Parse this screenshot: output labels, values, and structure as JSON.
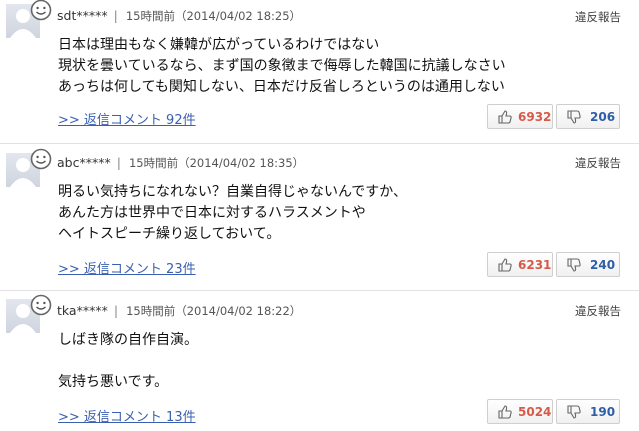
{
  "report_label": "違反報告",
  "comments": [
    {
      "user": "sdt*****",
      "separator": "|",
      "meta": "15時間前（2014/04/02 18:25）",
      "lines": [
        "日本は理由もなく嫌韓が広がっているわけではない",
        "現状を曇いているなら、まず国の象徴まで侮辱した韓国に抗議しなさい",
        "あっちは何しても関知しない、日本だけ反省しろというのは通用しない"
      ],
      "reply": ">> 返信コメント 92件",
      "likes": "6932",
      "dislikes": "206"
    },
    {
      "user": "abc*****",
      "separator": "|",
      "meta": "15時間前（2014/04/02 18:35）",
      "lines": [
        "明るい気持ちになれない？自業自得じゃないんですか、",
        "あんた方は世界中で日本に対するハラスメントや",
        "ヘイトスピーチ繰り返しておいて。"
      ],
      "reply": ">> 返信コメント 23件",
      "likes": "6231",
      "dislikes": "240"
    },
    {
      "user": "tka*****",
      "separator": "|",
      "meta": "15時間前（2014/04/02 18:22）",
      "lines": [
        "しばき隊の自作自演。",
        "",
        "気持ち悪いです。"
      ],
      "reply": ">> 返信コメント 13件",
      "likes": "5024",
      "dislikes": "190"
    }
  ],
  "colors": {
    "like": "#d65a4a",
    "dislike": "#2f5ea8",
    "link": "#3a5fb0"
  }
}
